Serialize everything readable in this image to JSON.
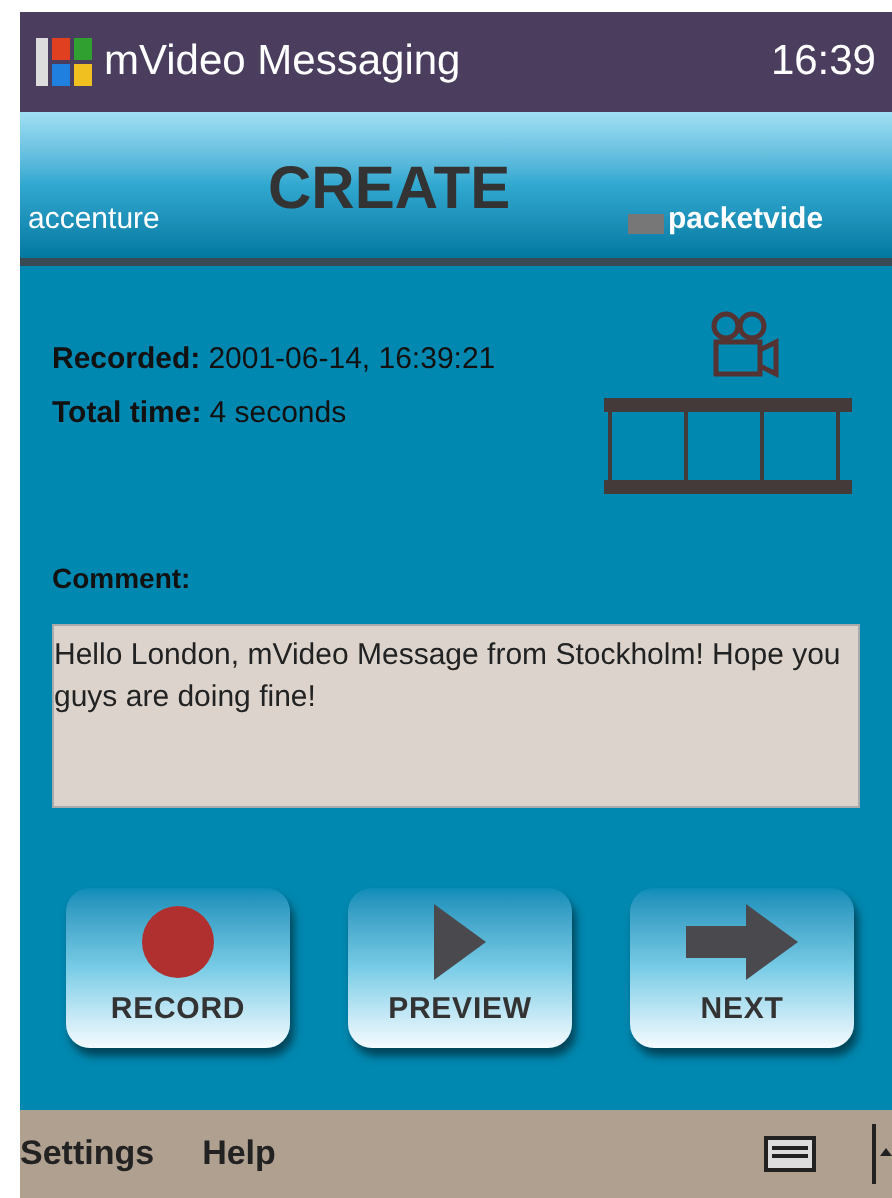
{
  "title_bar": {
    "title": "mVideo Messaging",
    "time": "16:39"
  },
  "header": {
    "left_logo": "accenture",
    "title": "CREATE",
    "right_logo": "packetvide"
  },
  "info": [
    {
      "label": "Recorded:",
      "value": "2001-06-14, 16:39:21"
    },
    {
      "label": "Total time:",
      "value": "4 seconds"
    }
  ],
  "comment": {
    "label": "Comment:",
    "value": "Hello London, mVideo Message from Stockholm! Hope you guys are doing fine!"
  },
  "buttons": [
    {
      "label": "RECORD",
      "kind": "record"
    },
    {
      "label": "PREVIEW",
      "kind": "play"
    },
    {
      "label": "NEXT",
      "kind": "next"
    }
  ],
  "menu_bar": [
    "Settings",
    "Help"
  ]
}
